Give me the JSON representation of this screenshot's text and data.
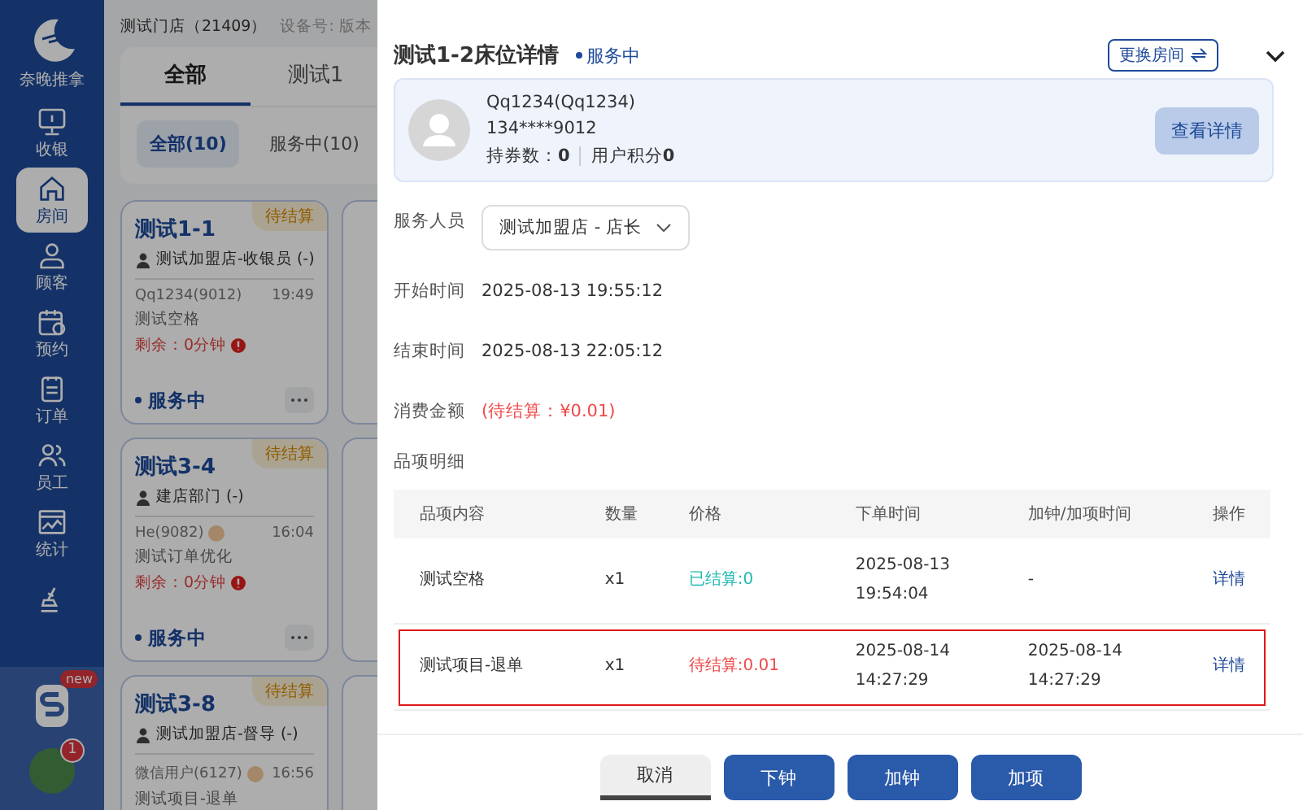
{
  "sidebar": {
    "logo_text": "奈晚推拿",
    "items": [
      {
        "kind": "monitor",
        "label": "收银",
        "selected": false
      },
      {
        "kind": "house",
        "label": "房间",
        "selected": true
      },
      {
        "kind": "person",
        "label": "顾客",
        "selected": false
      },
      {
        "kind": "calendar",
        "label": "预约",
        "selected": false
      },
      {
        "kind": "clipboard",
        "label": "订单",
        "selected": false
      },
      {
        "kind": "people",
        "label": "员工",
        "selected": false
      },
      {
        "kind": "chart",
        "label": "统计",
        "selected": false
      },
      {
        "kind": "broom",
        "selected": false
      }
    ],
    "app_badge": "new",
    "notification_count": "1"
  },
  "background": {
    "store_title": "测试门店（21409）",
    "device_label": "设备号: 版本",
    "tabs": [
      {
        "label": "全部",
        "selected": true
      },
      {
        "label": "测试1",
        "selected": false
      }
    ],
    "filters": [
      {
        "label": "全部(10)",
        "selected": true
      },
      {
        "label": "服务中(10)",
        "selected": false
      }
    ],
    "cards": [
      {
        "room": "测试1-1",
        "badge": "待结算",
        "staff": "测试加盟店-收银员 (-)",
        "customer": "Qq1234(9012)",
        "member": false,
        "time": "19:49",
        "item": "测试空格",
        "remaining": "剩余：0分钟",
        "status": "服务中"
      },
      {
        "room": "测试3-4",
        "badge": "待结算",
        "staff": "建店部门 (-)",
        "customer": "He(9082)",
        "member": true,
        "time": "16:04",
        "item": "测试订单优化",
        "remaining": "剩余：0分钟",
        "status": "服务中"
      },
      {
        "room": "测试3-8",
        "badge": "待结算",
        "staff": "测试加盟店-督导 (-)",
        "customer": "微信用户(6127)",
        "member": true,
        "time": "16:56",
        "item": "测试项目-退单"
      }
    ]
  },
  "panel": {
    "title": "测试1-2床位详情",
    "status": "服务中",
    "change_room_button": "更换房间",
    "customer": {
      "name": "Qq1234(Qq1234)",
      "phone": "134****9012",
      "coupons_label": "持券数：",
      "coupons_value": "0",
      "points_label": "用户积分",
      "points_value": "0",
      "details_button": "查看详情"
    },
    "staff_label": "服务人员",
    "staff_value": "测试加盟店 - 店长",
    "fields": [
      {
        "label": "开始时间",
        "value": "2025-08-13 19:55:12",
        "kind": "plain"
      },
      {
        "label": "结束时间",
        "value": "2025-08-13 22:05:12",
        "kind": "plain"
      },
      {
        "label": "消费金额",
        "value": "(待结算：¥0.01)",
        "kind": "pending"
      }
    ],
    "items_label": "品项明细",
    "table": {
      "columns": [
        "品项内容",
        "数量",
        "价格",
        "下单时间",
        "加钟/加项时间",
        "操作"
      ],
      "rows": [
        {
          "name": "测试空格",
          "qty": "x1",
          "price": "已结算:0",
          "settled": true,
          "order_time": [
            "2025-08-13",
            "19:54:04"
          ],
          "add_time": [
            "-"
          ],
          "action": "详情",
          "highlighted": false
        },
        {
          "name": "测试项目-退单",
          "qty": "x1",
          "price": "待结算:0.01",
          "settled": false,
          "order_time": [
            "2025-08-14",
            "14:27:29"
          ],
          "add_time": [
            "2025-08-14",
            "14:27:29"
          ],
          "action": "详情",
          "highlighted": true
        }
      ]
    },
    "buttons": [
      {
        "label": "取消",
        "kind": "secondary"
      },
      {
        "label": "下钟",
        "kind": "primary"
      },
      {
        "label": "加钟",
        "kind": "primary"
      },
      {
        "label": "加项",
        "kind": "primary"
      }
    ]
  }
}
